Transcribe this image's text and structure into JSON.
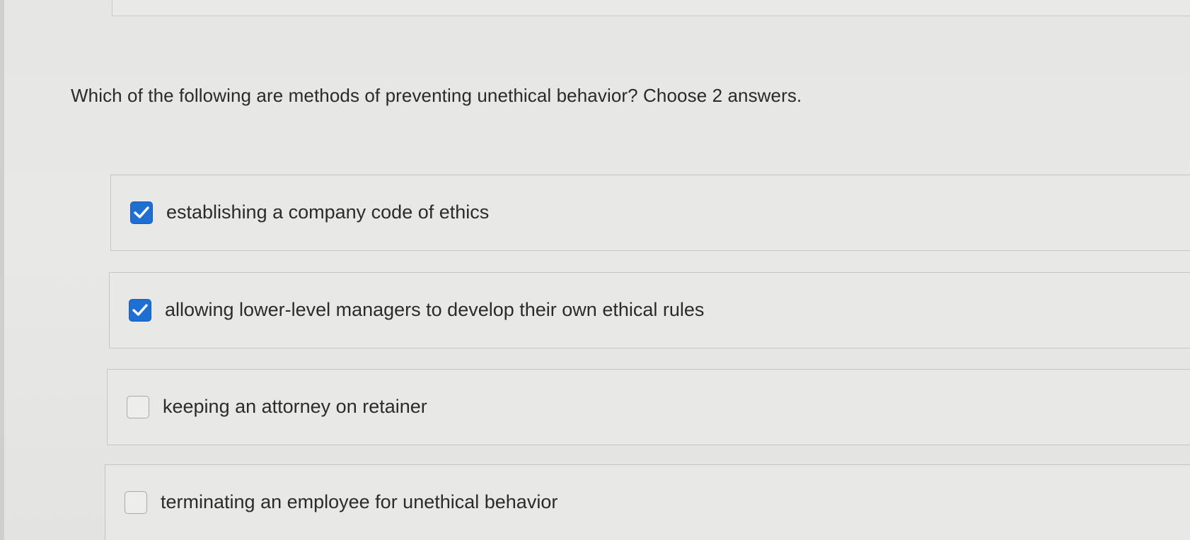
{
  "question": {
    "text": "Which of the following are methods of preventing unethical behavior? Choose 2 answers."
  },
  "options": [
    {
      "label": "establishing a company code of ethics",
      "checked": true
    },
    {
      "label": "allowing lower-level managers to develop their own ethical rules",
      "checked": true
    },
    {
      "label": "keeping an attorney on retainer",
      "checked": false
    },
    {
      "label": "terminating an employee for unethical behavior",
      "checked": false
    }
  ],
  "colors": {
    "checkbox_checked": "#1f6fd3",
    "checkbox_unchecked_border": "#a9a9a7",
    "background": "#e7e7e5"
  },
  "icons": {
    "checked": "checkmark-icon",
    "unchecked": "empty-checkbox-icon"
  }
}
